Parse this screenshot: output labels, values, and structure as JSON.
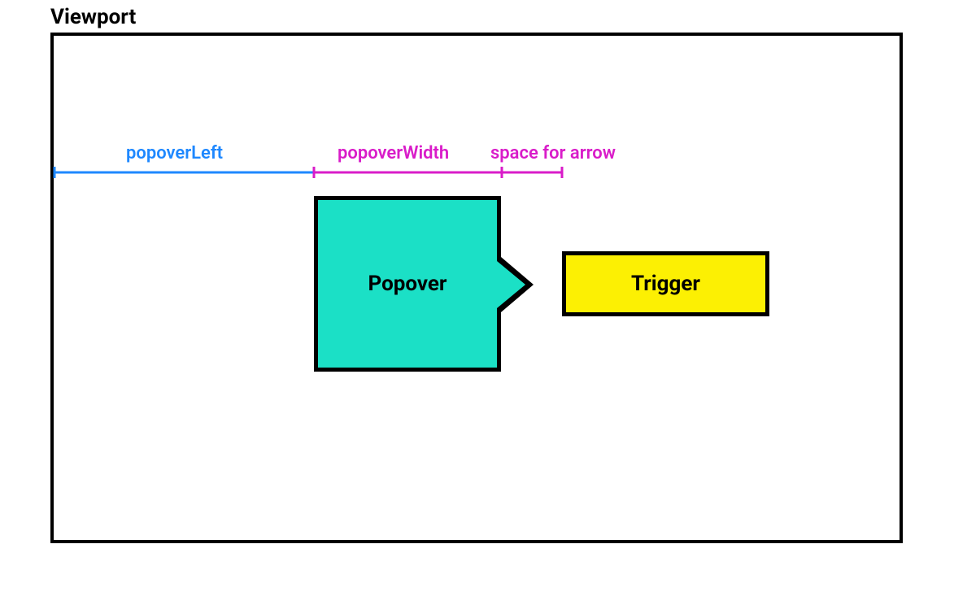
{
  "title": "Viewport",
  "labels": {
    "popoverLeft": "popoverLeft",
    "popoverWidth": "popoverWidth",
    "spaceForArrow": "space for arrow"
  },
  "boxes": {
    "popover": "Popover",
    "trigger": "Trigger"
  },
  "colors": {
    "popoverLeft": "#1e88ff",
    "popoverWidth": "#d91cc9",
    "spaceForArrow": "#d91cc9",
    "popoverFill": "#1be0c6",
    "triggerFill": "#fcf003",
    "border": "#000000"
  }
}
